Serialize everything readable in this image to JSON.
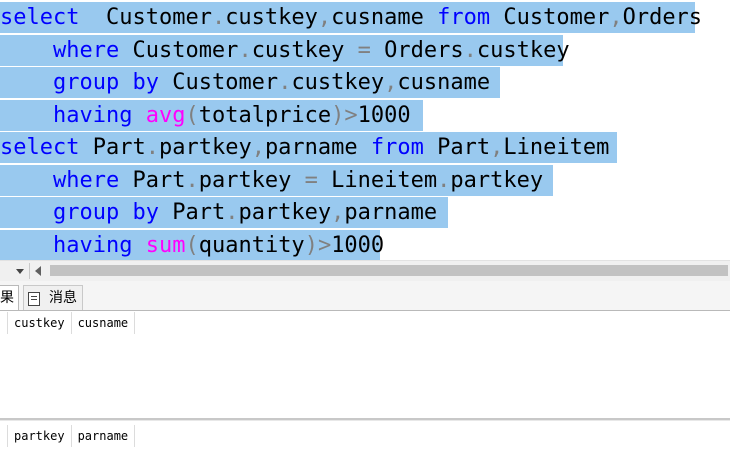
{
  "editor": {
    "lines": [
      {
        "tokens": [
          [
            "kw",
            "select"
          ],
          [
            "",
            "  Customer"
          ],
          [
            "op",
            "."
          ],
          [
            "",
            "custkey"
          ],
          [
            "op",
            ","
          ],
          [
            "",
            "cusname "
          ],
          [
            "kw",
            "from"
          ],
          [
            "",
            " Customer"
          ],
          [
            "op",
            ","
          ],
          [
            "",
            "Orders"
          ]
        ]
      },
      {
        "tokens": [
          [
            "",
            "    "
          ],
          [
            "kw",
            "where"
          ],
          [
            "",
            " Customer"
          ],
          [
            "op",
            "."
          ],
          [
            "",
            "custkey "
          ],
          [
            "op",
            "="
          ],
          [
            "",
            " Orders"
          ],
          [
            "op",
            "."
          ],
          [
            "",
            "custkey"
          ]
        ]
      },
      {
        "tokens": [
          [
            "",
            "    "
          ],
          [
            "kw",
            "group"
          ],
          [
            "",
            " "
          ],
          [
            "kw",
            "by"
          ],
          [
            "",
            " Customer"
          ],
          [
            "op",
            "."
          ],
          [
            "",
            "custkey"
          ],
          [
            "op",
            ","
          ],
          [
            "",
            "cusname"
          ]
        ]
      },
      {
        "tokens": [
          [
            "",
            "    "
          ],
          [
            "kw",
            "having"
          ],
          [
            "",
            " "
          ],
          [
            "fn",
            "avg"
          ],
          [
            "op",
            "("
          ],
          [
            "",
            "totalprice"
          ],
          [
            "op",
            ")"
          ],
          [
            "op",
            ">"
          ],
          [
            "",
            "1000"
          ]
        ]
      },
      {
        "tokens": [
          [
            "kw",
            "select"
          ],
          [
            "",
            " Part"
          ],
          [
            "op",
            "."
          ],
          [
            "",
            "partkey"
          ],
          [
            "op",
            ","
          ],
          [
            "",
            "parname "
          ],
          [
            "kw",
            "from"
          ],
          [
            "",
            " Part"
          ],
          [
            "op",
            ","
          ],
          [
            "",
            "Lineitem"
          ]
        ]
      },
      {
        "tokens": [
          [
            "",
            "    "
          ],
          [
            "kw",
            "where"
          ],
          [
            "",
            " Part"
          ],
          [
            "op",
            "."
          ],
          [
            "",
            "partkey "
          ],
          [
            "op",
            "="
          ],
          [
            "",
            " Lineitem"
          ],
          [
            "op",
            "."
          ],
          [
            "",
            "partkey"
          ]
        ]
      },
      {
        "tokens": [
          [
            "",
            "    "
          ],
          [
            "kw",
            "group"
          ],
          [
            "",
            " "
          ],
          [
            "kw",
            "by"
          ],
          [
            "",
            " Part"
          ],
          [
            "op",
            "."
          ],
          [
            "",
            "partkey"
          ],
          [
            "op",
            ","
          ],
          [
            "",
            "parname"
          ]
        ]
      },
      {
        "tokens": [
          [
            "",
            "    "
          ],
          [
            "kw",
            "having"
          ],
          [
            "",
            " "
          ],
          [
            "fn",
            "sum"
          ],
          [
            "op",
            "("
          ],
          [
            "",
            "quantity"
          ],
          [
            "op",
            ")"
          ],
          [
            "op",
            ">"
          ],
          [
            "",
            "1000"
          ]
        ]
      }
    ]
  },
  "tabs": {
    "results_label": "果",
    "messages_label": "消息",
    "messages_icon": "document-icon"
  },
  "grids": [
    {
      "columns": [
        "custkey",
        "cusname"
      ]
    },
    {
      "columns": [
        "partkey",
        "parname"
      ]
    }
  ],
  "colors": {
    "keyword": "#0000ff",
    "function": "#ff00ff",
    "operator": "#808080",
    "selection": "#99c9ef"
  }
}
